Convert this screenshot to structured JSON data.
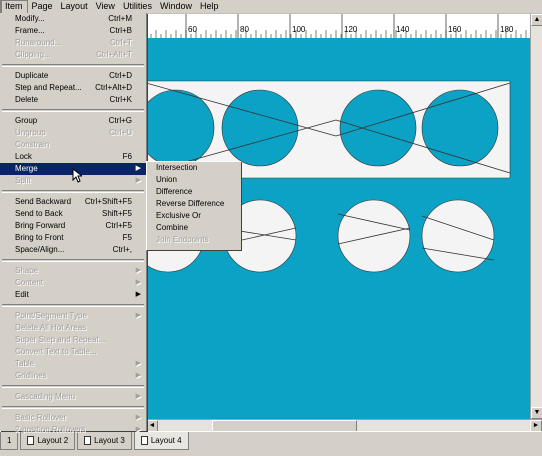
{
  "menubar": {
    "items": [
      "Item",
      "Page",
      "Layout",
      "View",
      "Utilities",
      "Window",
      "Help"
    ],
    "active": 0
  },
  "ruler": {
    "labels": [
      "60",
      "80",
      "100",
      "120",
      "140",
      "160",
      "180"
    ]
  },
  "item_menu": {
    "items": [
      {
        "label": "Modify...",
        "shortcut": "Ctrl+M",
        "disabled": false
      },
      {
        "label": "Frame...",
        "shortcut": "Ctrl+B",
        "disabled": false
      },
      {
        "label": "Runaround...",
        "shortcut": "Ctrl+T",
        "disabled": true
      },
      {
        "label": "Clipping...",
        "shortcut": "Ctrl+Alt+T",
        "disabled": true
      },
      {
        "sep": true
      },
      {
        "label": "Duplicate",
        "shortcut": "Ctrl+D",
        "disabled": false
      },
      {
        "label": "Step and Repeat...",
        "shortcut": "Ctrl+Alt+D",
        "disabled": false
      },
      {
        "label": "Delete",
        "shortcut": "Ctrl+K",
        "disabled": false
      },
      {
        "sep": true
      },
      {
        "label": "Group",
        "shortcut": "Ctrl+G",
        "disabled": false
      },
      {
        "label": "Ungroup",
        "shortcut": "Ctrl+U",
        "disabled": true
      },
      {
        "label": "Constrain",
        "shortcut": "",
        "disabled": true
      },
      {
        "label": "Lock",
        "shortcut": "F6",
        "disabled": false
      },
      {
        "label": "Merge",
        "shortcut": "",
        "disabled": false,
        "submenu": true,
        "highlighted": true
      },
      {
        "label": "Split",
        "shortcut": "",
        "disabled": true,
        "submenu": true
      },
      {
        "sep": true
      },
      {
        "label": "Send Backward",
        "shortcut": "Ctrl+Shift+F5",
        "disabled": false
      },
      {
        "label": "Send to Back",
        "shortcut": "Shift+F5",
        "disabled": false
      },
      {
        "label": "Bring Forward",
        "shortcut": "Ctrl+F5",
        "disabled": false
      },
      {
        "label": "Bring to Front",
        "shortcut": "F5",
        "disabled": false
      },
      {
        "label": "Space/Align...",
        "shortcut": "Ctrl+,",
        "disabled": false
      },
      {
        "sep": true
      },
      {
        "label": "Shape",
        "shortcut": "",
        "disabled": true,
        "submenu": true
      },
      {
        "label": "Content",
        "shortcut": "",
        "disabled": true,
        "submenu": true
      },
      {
        "label": "Edit",
        "shortcut": "",
        "disabled": false,
        "submenu": true
      },
      {
        "sep": true
      },
      {
        "label": "Point/Segment Type",
        "shortcut": "",
        "disabled": true,
        "submenu": true
      },
      {
        "label": "Delete All Hot Areas",
        "shortcut": "",
        "disabled": true
      },
      {
        "label": "Super Step and Repeat...",
        "shortcut": "",
        "disabled": true
      },
      {
        "label": "Convert Text to Table...",
        "shortcut": "",
        "disabled": true
      },
      {
        "label": "Table",
        "shortcut": "",
        "disabled": true,
        "submenu": true
      },
      {
        "label": "Gridlines",
        "shortcut": "",
        "disabled": true,
        "submenu": true
      },
      {
        "sep": true
      },
      {
        "label": "Cascading Menu",
        "shortcut": "",
        "disabled": true,
        "submenu": true
      },
      {
        "sep": true
      },
      {
        "label": "Basic Rollover",
        "shortcut": "",
        "disabled": true,
        "submenu": true
      },
      {
        "label": "2-position Rollovers",
        "shortcut": "",
        "disabled": true,
        "submenu": true
      }
    ]
  },
  "merge_submenu": {
    "items": [
      {
        "label": "Intersection",
        "disabled": false
      },
      {
        "label": "Union",
        "disabled": false
      },
      {
        "label": "Difference",
        "disabled": false
      },
      {
        "label": "Reverse Difference",
        "disabled": false
      },
      {
        "label": "Exclusive Or",
        "disabled": false
      },
      {
        "label": "Combine",
        "disabled": false
      },
      {
        "label": "Join Endpoints",
        "disabled": true
      }
    ]
  },
  "layout_tabs": {
    "items": [
      "1",
      "Layout 2",
      "Layout 3",
      "Layout 4"
    ],
    "active": 3
  },
  "colors": {
    "canvas": "#0ba2c5",
    "shape": "#ffffff",
    "menu_highlight": "#0a246a"
  }
}
